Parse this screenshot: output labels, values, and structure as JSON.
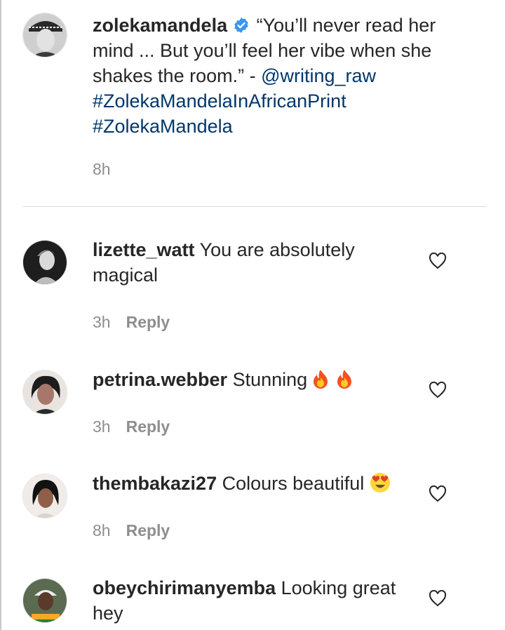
{
  "caption": {
    "username": "zolekamandela",
    "quote": "“You’ll never read her mind ... But you’ll feel her vibe when she shakes the room.” - ",
    "mention": "@writing_raw",
    "hashtags": [
      "#ZolekaMandelaInAfricanPrint",
      "#ZolekaMandela"
    ],
    "time": "8h"
  },
  "comments": [
    {
      "username": "lizette_watt",
      "text": "You are absolutely magical",
      "time": "3h",
      "reply_label": "Reply",
      "emojis": []
    },
    {
      "username": "petrina.webber",
      "text": "Stunning",
      "time": "3h",
      "reply_label": "Reply",
      "emojis": [
        "fire-emoji",
        "fire-emoji"
      ]
    },
    {
      "username": "thembakazi27",
      "text": "Colours beautiful",
      "time": "8h",
      "reply_label": "Reply",
      "emojis": [
        "heart-eyes-emoji"
      ]
    },
    {
      "username": "obeychirimanyemba",
      "text": "Looking great hey",
      "emojis": []
    }
  ],
  "colors": {
    "link": "#00376b",
    "verified": "#3897f0",
    "secondary_text": "#8e8e8e",
    "primary_text": "#262626"
  }
}
